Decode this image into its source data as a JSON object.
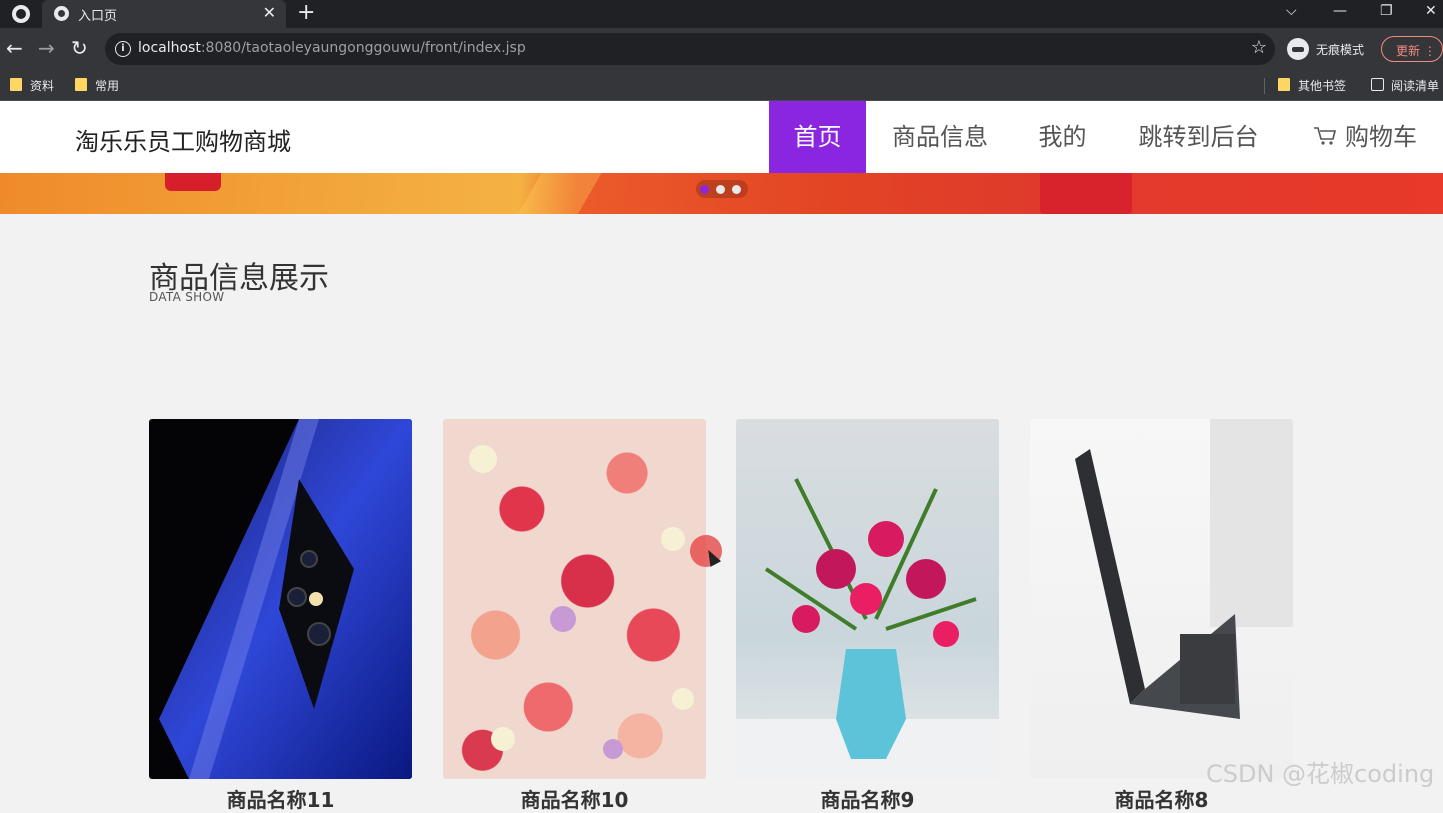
{
  "browser": {
    "tab_title": "入口页",
    "url_host": "localhost",
    "url_rest": ":8080/taotaoleyaungonggouwu/front/index.jsp",
    "incognito_label": "无痕模式",
    "update_label": "更新",
    "bookmarks": [
      "资料",
      "常用",
      "其他书签",
      "阅读清单"
    ]
  },
  "site": {
    "title": "淘乐乐员工购物商城",
    "nav": [
      {
        "label": "首页",
        "active": true
      },
      {
        "label": "商品信息",
        "active": false
      },
      {
        "label": "我的",
        "active": false
      },
      {
        "label": "跳转到后台",
        "active": false
      },
      {
        "label": "购物车",
        "active": false
      }
    ],
    "accent_color": "#8a26e0"
  },
  "carousel": {
    "slides": 3,
    "active_index": 0
  },
  "section": {
    "title": "商品信息展示",
    "subtitle": "DATA SHOW"
  },
  "products": [
    {
      "name": "商品名称11",
      "image": "phone-image"
    },
    {
      "name": "商品名称10",
      "image": "flowers-image"
    },
    {
      "name": "商品名称9",
      "image": "lily-vase-image"
    },
    {
      "name": "商品名称8",
      "image": "laptop-image"
    }
  ],
  "watermark": "CSDN @花椒coding"
}
